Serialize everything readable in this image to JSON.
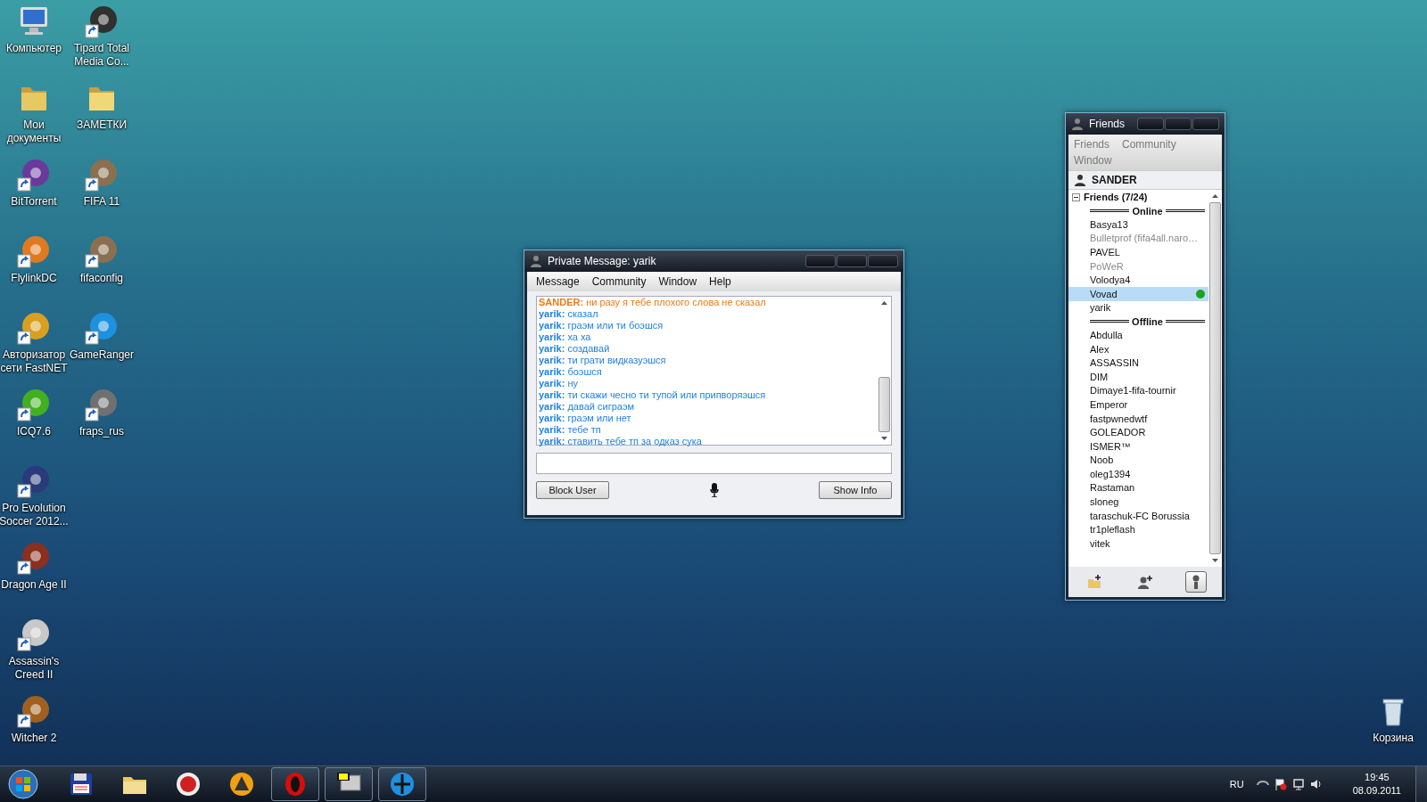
{
  "desktop": {
    "icons_left": [
      {
        "label": "Компьютер",
        "kind": "computer",
        "shortcut": false,
        "color": "#2f6fd0"
      },
      {
        "label": "Мои документы",
        "kind": "folder",
        "shortcut": false,
        "color": "#e8c860"
      },
      {
        "label": "BitTorrent",
        "kind": "app",
        "shortcut": true,
        "color": "#6a3a9a"
      },
      {
        "label": "FlylinkDC",
        "kind": "app",
        "shortcut": true,
        "color": "#e07a20"
      },
      {
        "label": "Авторизатор сети FastNET",
        "kind": "app",
        "shortcut": true,
        "color": "#d9a020"
      },
      {
        "label": "ICQ7.6",
        "kind": "app",
        "shortcut": true,
        "color": "#40b020"
      },
      {
        "label": "Pro Evolution Soccer 2012...",
        "kind": "app",
        "shortcut": true,
        "color": "#2a3a7a"
      },
      {
        "label": "Dragon Age II",
        "kind": "app",
        "shortcut": true,
        "color": "#8a3020"
      },
      {
        "label": "Assassin's Creed II",
        "kind": "app",
        "shortcut": true,
        "color": "#c8c8c8"
      },
      {
        "label": "Witcher 2",
        "kind": "app",
        "shortcut": true,
        "color": "#a06020"
      }
    ],
    "icons_right": [
      {
        "label": "Tipard Total Media Co...",
        "kind": "app",
        "shortcut": true,
        "color": "#303030"
      },
      {
        "label": "ЗАМЕТКИ",
        "kind": "folder",
        "shortcut": false,
        "color": "#f0d878"
      },
      {
        "label": "FIFA 11",
        "kind": "app",
        "shortcut": true,
        "color": "#8a7050"
      },
      {
        "label": "fifaconfig",
        "kind": "app",
        "shortcut": true,
        "color": "#8a7050"
      },
      {
        "label": "GameRanger",
        "kind": "app",
        "shortcut": true,
        "color": "#1e90e0"
      },
      {
        "label": "fraps_rus",
        "kind": "app",
        "shortcut": true,
        "color": "#707070"
      }
    ],
    "recycle_bin": {
      "label": "Корзина"
    }
  },
  "chat_window": {
    "title": "Private Message: yarik",
    "menu": [
      "Message",
      "Community",
      "Window",
      "Help"
    ],
    "messages": [
      {
        "text": "**SANDER:** ни разу я тебе плохого слова не сказал",
        "self": true
      },
      {
        "text": "**yarik:** сказал",
        "self": false
      },
      {
        "text": "**yarik:** граэм или ти боэшся",
        "self": false
      },
      {
        "text": "**yarik:** ха ха",
        "self": false
      },
      {
        "text": "**yarik:** создавай",
        "self": false
      },
      {
        "text": "**yarik:** ти грати видказуэшся",
        "self": false
      },
      {
        "text": "**yarik:** боэшся",
        "self": false
      },
      {
        "text": "**yarik:** ну",
        "self": false
      },
      {
        "text": "**yarik:** ти скажи чесно ти тупой или припворяэшся",
        "self": false
      },
      {
        "text": "**yarik:** давай сиграэм",
        "self": false
      },
      {
        "text": "**yarik:** граэм или нет",
        "self": false
      },
      {
        "text": "**yarik:** тебе тп",
        "self": false
      },
      {
        "text": "**yarik:** ставить тебе тп за одказ сука",
        "self": false
      }
    ],
    "buttons": [
      "Block User",
      "Show Info"
    ]
  },
  "friends_window": {
    "title": "Friends",
    "menu": [
      "Friends",
      "Community",
      "Window"
    ],
    "user": "SANDER",
    "group": {
      "label": "Friends (7/24)",
      "expanded": true,
      "sections": [
        {
          "title": "Online",
          "friends": [
            {
              "name": "Basya13",
              "away": false,
              "selected": false,
              "in_game": false
            },
            {
              "name": "Bulletprof (fifa4all.naro…",
              "away": true,
              "selected": false,
              "in_game": false
            },
            {
              "name": "PAVEL",
              "away": false,
              "selected": false,
              "in_game": false
            },
            {
              "name": "PoWeR",
              "away": true,
              "selected": false,
              "in_game": false
            },
            {
              "name": "Volodya4",
              "away": false,
              "selected": false,
              "in_game": false
            },
            {
              "name": "Vovad",
              "away": false,
              "selected": true,
              "in_game": true
            },
            {
              "name": "yarik",
              "away": false,
              "selected": false,
              "in_game": false
            }
          ]
        },
        {
          "title": "Offline",
          "friends": [
            {
              "name": "Abdulla",
              "away": false,
              "selected": false,
              "in_game": false
            },
            {
              "name": "Alex",
              "away": false,
              "selected": false,
              "in_game": false
            },
            {
              "name": "ASSASSIN",
              "away": false,
              "selected": false,
              "in_game": false
            },
            {
              "name": "DIM",
              "away": false,
              "selected": false,
              "in_game": false
            },
            {
              "name": "Dimaye1-fifa-tournir",
              "away": false,
              "selected": false,
              "in_game": false
            },
            {
              "name": "Emperor",
              "away": false,
              "selected": false,
              "in_game": false
            },
            {
              "name": "fastpwnedwtf",
              "away": false,
              "selected": false,
              "in_game": false
            },
            {
              "name": "GOLEADOR",
              "away": false,
              "selected": false,
              "in_game": false
            },
            {
              "name": "ISMER™",
              "away": false,
              "selected": false,
              "in_game": false
            },
            {
              "name": "Noob",
              "away": false,
              "selected": false,
              "in_game": false
            },
            {
              "name": "oleg1394",
              "away": false,
              "selected": false,
              "in_game": false
            },
            {
              "name": "Rastaman",
              "away": false,
              "selected": false,
              "in_game": false
            },
            {
              "name": "sloneg",
              "away": false,
              "selected": false,
              "in_game": false
            },
            {
              "name": "taraschuk-FC Borussia",
              "away": false,
              "selected": false,
              "in_game": false
            },
            {
              "name": "tr1pleflash",
              "away": false,
              "selected": false,
              "in_game": false
            },
            {
              "name": "vitek",
              "away": false,
              "selected": false,
              "in_game": false
            }
          ]
        }
      ]
    },
    "toolbar": [
      {
        "kind": "add-folder",
        "selected": false
      },
      {
        "kind": "add-user",
        "selected": false
      },
      {
        "kind": "user",
        "selected": true
      }
    ]
  },
  "taskbar": {
    "apps": [
      {
        "kind": "floppy",
        "active": false
      },
      {
        "kind": "folder",
        "active": false
      },
      {
        "kind": "red-circle",
        "active": false
      },
      {
        "kind": "orange-circle",
        "active": false
      },
      {
        "kind": "opera",
        "active": true
      },
      {
        "kind": "monitor",
        "active": true
      },
      {
        "kind": "gameranger",
        "active": true
      }
    ],
    "language": "RU",
    "time": "19:45",
    "date": "08.09.2011"
  }
}
